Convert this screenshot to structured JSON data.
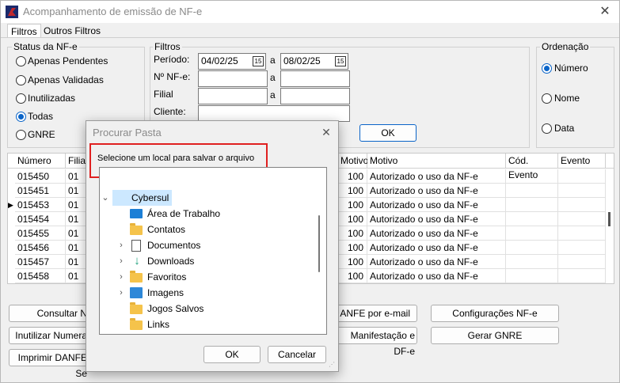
{
  "window": {
    "title": "Acompanhamento de emissão de NF-e"
  },
  "tabs": [
    "Filtros",
    "Outros Filtros"
  ],
  "status": {
    "label": "Status da NF-e",
    "options": [
      "Apenas Pendentes",
      "Apenas Validadas",
      "Inutilizadas",
      "Todas",
      "GNRE"
    ],
    "selected": "Todas"
  },
  "filtros": {
    "label": "Filtros",
    "periodo_label": "Período:",
    "periodo_from": "04/02/25",
    "periodo_to": "08/02/25",
    "nf_label": "Nº NF-e:",
    "filial_label": "Filial",
    "cliente_label": "Cliente:",
    "sep": "a",
    "ok": "OK",
    "cal_glyph": "15"
  },
  "ordenacao": {
    "label": "Ordenação",
    "options": [
      "Número",
      "Nome",
      "Data"
    ],
    "selected": "Número"
  },
  "grid": {
    "headers": [
      "Número",
      "Filial",
      "Motivo",
      "Motivo",
      "Cód. Evento",
      "Evento"
    ],
    "current_row_marker": "▶",
    "rows": [
      {
        "numero": "015450",
        "filial": "01",
        "motivo_code": "100",
        "motivo": "Autorizado o uso da NF-e"
      },
      {
        "numero": "015451",
        "filial": "01",
        "motivo_code": "100",
        "motivo": "Autorizado o uso da NF-e"
      },
      {
        "numero": "015453",
        "filial": "01",
        "motivo_code": "100",
        "motivo": "Autorizado o uso da NF-e"
      },
      {
        "numero": "015454",
        "filial": "01",
        "motivo_code": "100",
        "motivo": "Autorizado o uso da NF-e"
      },
      {
        "numero": "015455",
        "filial": "01",
        "motivo_code": "100",
        "motivo": "Autorizado o uso da NF-e"
      },
      {
        "numero": "015456",
        "filial": "01",
        "motivo_code": "100",
        "motivo": "Autorizado o uso da NF-e"
      },
      {
        "numero": "015457",
        "filial": "01",
        "motivo_code": "100",
        "motivo": "Autorizado o uso da NF-e"
      },
      {
        "numero": "015458",
        "filial": "01",
        "motivo_code": "100",
        "motivo": "Autorizado o uso da NF-e"
      }
    ],
    "current_row": 2
  },
  "buttons": {
    "consultar": "Consultar N",
    "inutilizar": "Inutilizar Numera",
    "imprimir": "Imprimir DANFE Se",
    "danfe_email": "ANFE por e-mail",
    "manifestacao": "Manifestação e DF-e",
    "configuracoes": "Configurações NF-e",
    "gerar_gnre": "Gerar GNRE"
  },
  "dialog": {
    "title": "Procurar Pasta",
    "message": "Selecione um local para salvar o arquivo",
    "tree": [
      {
        "label": "Cybersul",
        "icon": "folder",
        "expander": "open",
        "level": 0,
        "selected": true
      },
      {
        "label": "Área de Trabalho",
        "icon": "desktop",
        "expander": "",
        "level": 1
      },
      {
        "label": "Contatos",
        "icon": "folder",
        "expander": "",
        "level": 1
      },
      {
        "label": "Documentos",
        "icon": "documents",
        "expander": "closed",
        "level": 1
      },
      {
        "label": "Downloads",
        "icon": "download",
        "expander": "closed",
        "level": 1
      },
      {
        "label": "Favoritos",
        "icon": "folder",
        "expander": "closed",
        "level": 1
      },
      {
        "label": "Imagens",
        "icon": "pictures",
        "expander": "closed",
        "level": 1
      },
      {
        "label": "Jogos Salvos",
        "icon": "folder",
        "expander": "",
        "level": 1
      },
      {
        "label": "Links",
        "icon": "folder",
        "expander": "",
        "level": 1
      }
    ],
    "ok": "OK",
    "cancel": "Cancelar",
    "close_glyph": "✕"
  },
  "colors": {
    "accent": "#0a64c8",
    "highlight_box": "#e02020",
    "folder": "#f5c34b"
  }
}
